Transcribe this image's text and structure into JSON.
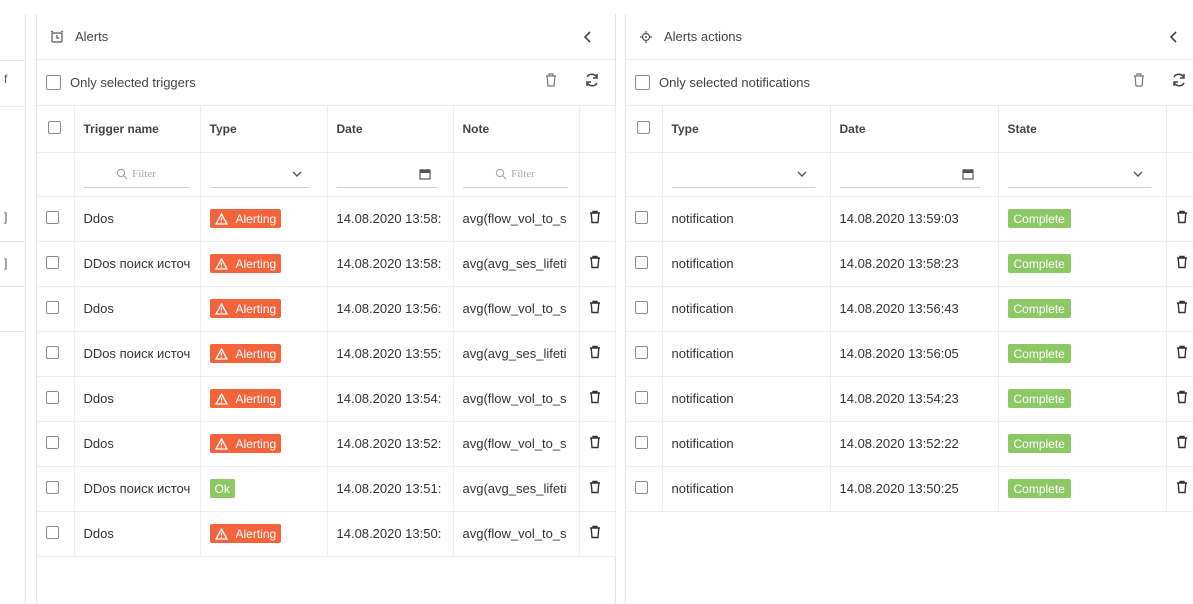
{
  "left_stub": {
    "marks": [
      "f",
      "]",
      "]"
    ]
  },
  "alerts_panel": {
    "title": "Alerts",
    "only_selected_label": "Only selected triggers",
    "columns": [
      "Trigger name",
      "Type",
      "Date",
      "Note"
    ],
    "filter_placeholder": "Filter",
    "rows": [
      {
        "name": "Ddos",
        "type": "Alerting",
        "date": "14.08.2020 13:58:",
        "note": "avg(flow_vol_to_s"
      },
      {
        "name": "DDos поиск источ",
        "type": "Alerting",
        "date": "14.08.2020 13:58:",
        "note": "avg(avg_ses_lifeti"
      },
      {
        "name": "Ddos",
        "type": "Alerting",
        "date": "14.08.2020 13:56:",
        "note": "avg(flow_vol_to_s"
      },
      {
        "name": "DDos поиск источ",
        "type": "Alerting",
        "date": "14.08.2020 13:55:",
        "note": "avg(avg_ses_lifeti"
      },
      {
        "name": "Ddos",
        "type": "Alerting",
        "date": "14.08.2020 13:54:",
        "note": "avg(flow_vol_to_s"
      },
      {
        "name": "Ddos",
        "type": "Alerting",
        "date": "14.08.2020 13:52:",
        "note": "avg(flow_vol_to_s"
      },
      {
        "name": "DDos поиск источ",
        "type": "Ok",
        "date": "14.08.2020 13:51:",
        "note": "avg(avg_ses_lifeti"
      },
      {
        "name": "Ddos",
        "type": "Alerting",
        "date": "14.08.2020 13:50:",
        "note": "avg(flow_vol_to_s"
      }
    ]
  },
  "actions_panel": {
    "title": "Alerts actions",
    "only_selected_label": "Only selected notifications",
    "columns": [
      "Type",
      "Date",
      "State"
    ],
    "rows": [
      {
        "type": "notification",
        "date": "14.08.2020 13:59:03",
        "state": "Complete"
      },
      {
        "type": "notification",
        "date": "14.08.2020 13:58:23",
        "state": "Complete"
      },
      {
        "type": "notification",
        "date": "14.08.2020 13:56:43",
        "state": "Complete"
      },
      {
        "type": "notification",
        "date": "14.08.2020 13:56:05",
        "state": "Complete"
      },
      {
        "type": "notification",
        "date": "14.08.2020 13:54:23",
        "state": "Complete"
      },
      {
        "type": "notification",
        "date": "14.08.2020 13:52:22",
        "state": "Complete"
      },
      {
        "type": "notification",
        "date": "14.08.2020 13:50:25",
        "state": "Complete"
      }
    ]
  },
  "colors": {
    "alerting": "#f4643c",
    "ok": "#8cc965",
    "complete": "#8cc965",
    "border": "#e3e3e3"
  },
  "icons": [
    "alarm-clock-icon",
    "crosshair-icon",
    "chevron-left-icon",
    "trash-icon",
    "refresh-icon",
    "search-icon",
    "chevron-down-icon",
    "calendar-icon",
    "warning-icon"
  ]
}
